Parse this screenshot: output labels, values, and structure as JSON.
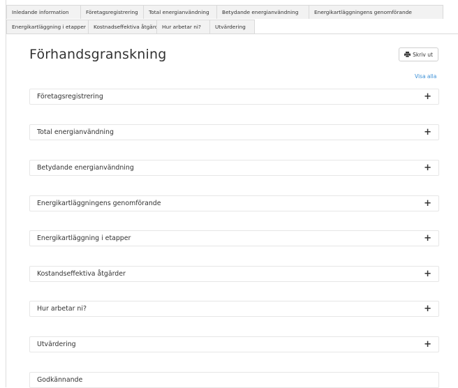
{
  "tabs": {
    "row1": [
      "Inledande information",
      "Företagsregistrering",
      "Total energianvändning",
      "Betydande energianvändning",
      "Energikartläggningens genomförande"
    ],
    "row2": [
      "Energikartläggning i etapper",
      "Kostnadseffektiva åtgärder",
      "Hur arbetar ni?",
      "Utvärdering"
    ]
  },
  "page": {
    "title": "Förhandsgranskning",
    "print_label": "Skriv ut",
    "print_icon": "printer-icon",
    "show_all_label": "Visa alla"
  },
  "sections": [
    {
      "label": "Företagsregistrering",
      "expand": "+"
    },
    {
      "label": "Total energianvändning",
      "expand": "+"
    },
    {
      "label": "Betydande energianvändning",
      "expand": "+"
    },
    {
      "label": "Energikartläggningens genomförande",
      "expand": "+"
    },
    {
      "label": "Energikartläggning i etapper",
      "expand": "+"
    },
    {
      "label": "Kostandseffektiva åtgärder",
      "expand": "+"
    },
    {
      "label": "Hur arbetar ni?",
      "expand": "+"
    },
    {
      "label": "Utvärdering",
      "expand": "+"
    },
    {
      "label": "Godkännande",
      "expand": ""
    }
  ]
}
